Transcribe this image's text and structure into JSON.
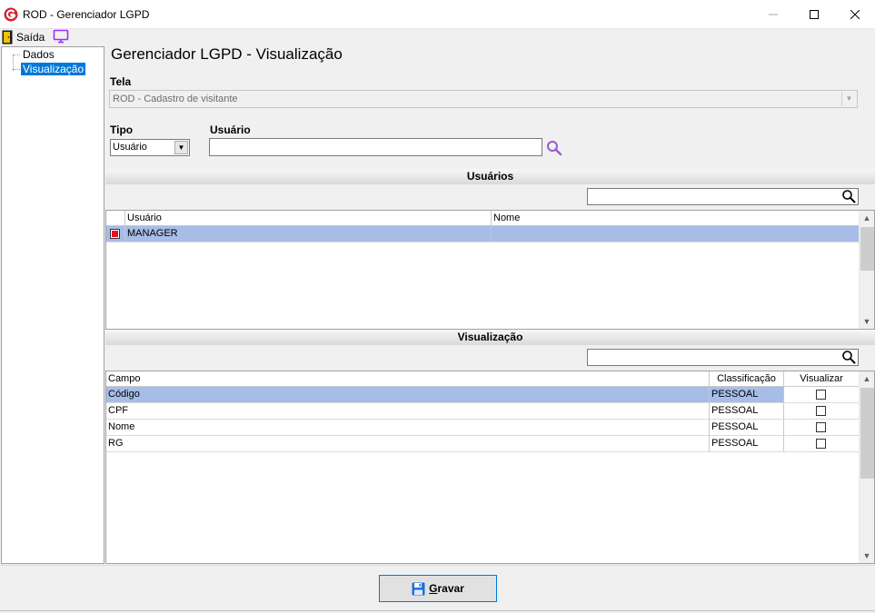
{
  "window": {
    "title": "ROD - Gerenciador LGPD",
    "accent": "#d1202f"
  },
  "toolbar": {
    "exit_label": "Saída"
  },
  "tree": {
    "items": [
      {
        "label": "Dados",
        "selected": false
      },
      {
        "label": "Visualização",
        "selected": true
      }
    ]
  },
  "page": {
    "title": "Gerenciador LGPD - Visualização"
  },
  "tela": {
    "label": "Tela",
    "value": "ROD - Cadastro de visitante"
  },
  "tipo": {
    "label": "Tipo",
    "value": "Usuário"
  },
  "usuario": {
    "label": "Usuário",
    "value": ""
  },
  "usuarios_section": {
    "title": "Usuários",
    "search_value": "",
    "columns": [
      "Usuário",
      "Nome"
    ],
    "rows": [
      {
        "checked": true,
        "usuario": "MANAGER",
        "nome": ""
      }
    ]
  },
  "visualizacao_section": {
    "title": "Visualização",
    "search_value": "",
    "columns": [
      "Campo",
      "Classificação",
      "Visualizar"
    ],
    "rows": [
      {
        "campo": "Código",
        "classificacao": "PESSOAL",
        "visualizar": false
      },
      {
        "campo": "CPF",
        "classificacao": "PESSOAL",
        "visualizar": false
      },
      {
        "campo": "Nome",
        "classificacao": "PESSOAL",
        "visualizar": false
      },
      {
        "campo": "RG",
        "classificacao": "PESSOAL",
        "visualizar": false
      }
    ]
  },
  "footer": {
    "save_mnemonic": "G",
    "save_rest": "ravar"
  },
  "colors": {
    "selection": "#0078d7",
    "row_highlight": "#a6bde8",
    "search_icon_accent": "#9b59d0",
    "monitor_icon": "#9b30ff"
  }
}
